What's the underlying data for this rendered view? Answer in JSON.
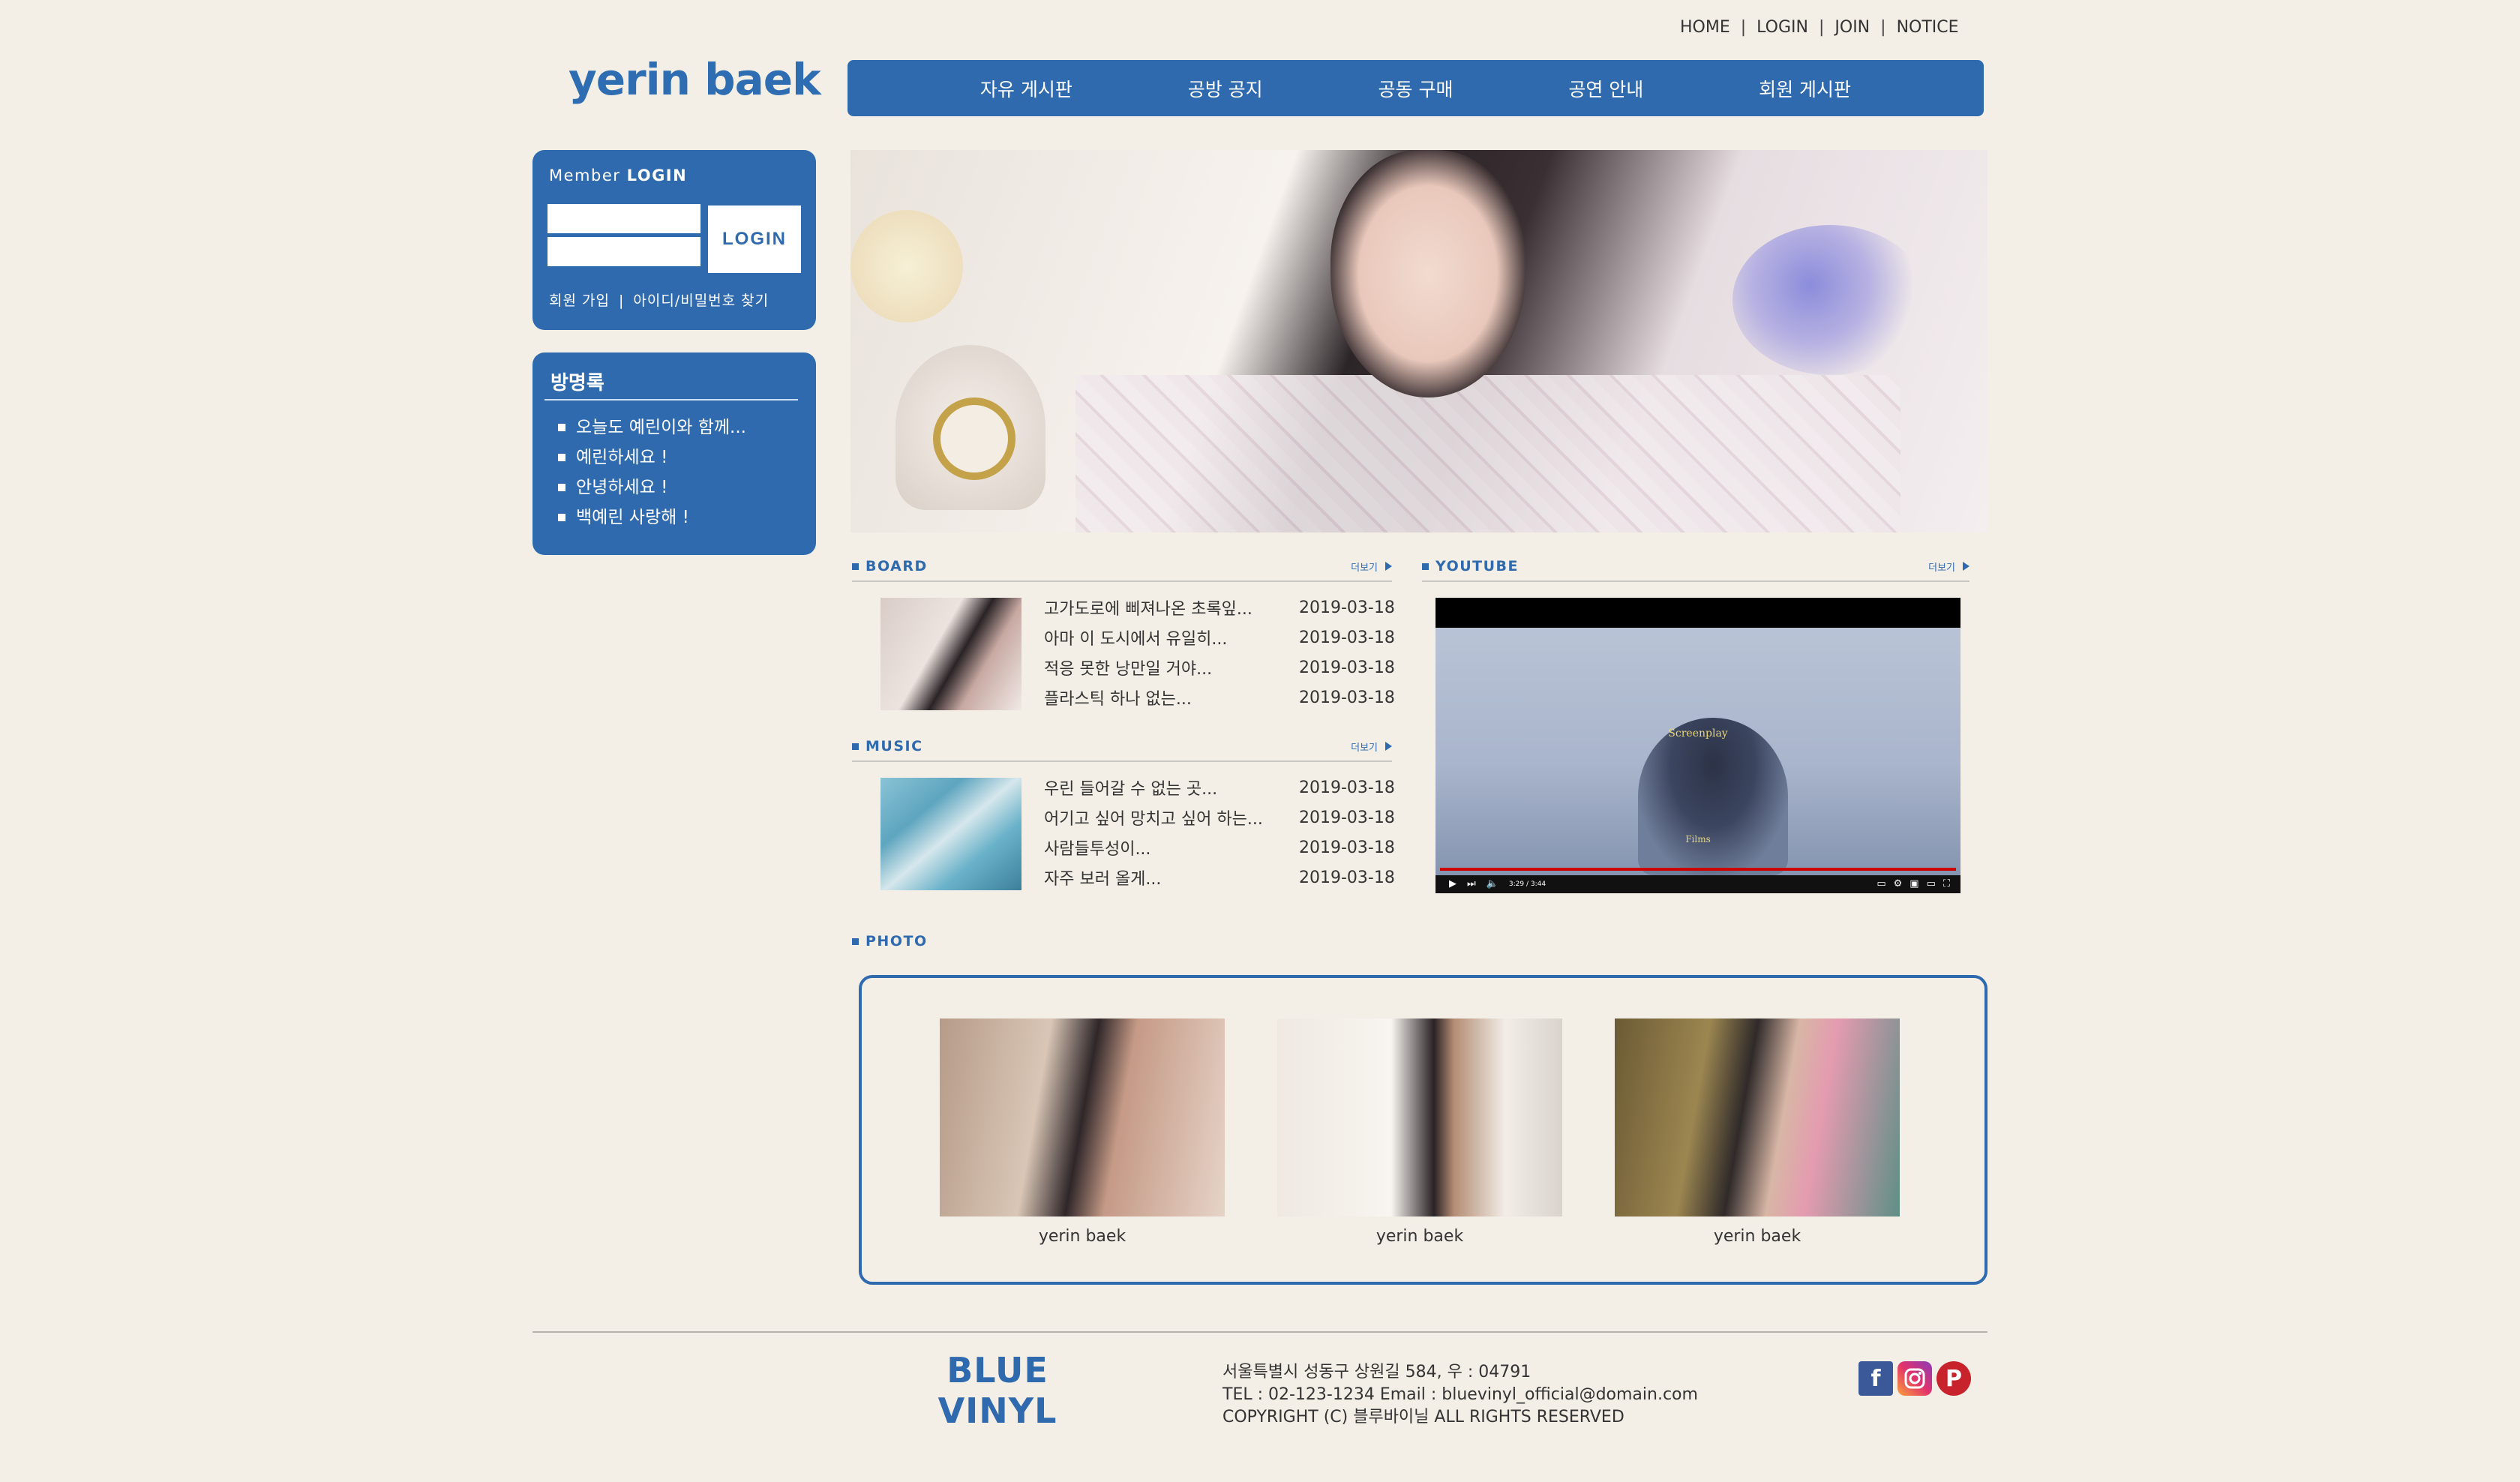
{
  "top_links": [
    "HOME",
    "LOGIN",
    "JOIN",
    "NOTICE"
  ],
  "logo": "yerin baek",
  "nav": [
    "자유 게시판",
    "공방 공지",
    "공동 구매",
    "공연 안내",
    "회원 게시판"
  ],
  "login": {
    "title_prefix": "Member",
    "title_bold": "LOGIN",
    "button": "LOGIN",
    "join": "회원 가입",
    "find": "아이디/비밀번호 찾기"
  },
  "guestbook": {
    "title": "방명록",
    "items": [
      "오늘도 예린이와 함께...",
      "예린하세요 !",
      "안녕하세요 !",
      "백예린 사랑해 !"
    ]
  },
  "board": {
    "title": "BOARD",
    "more": "더보기",
    "rows": [
      {
        "title": "고가도로에 삐져나온 초록잎...",
        "date": "2019-03-18"
      },
      {
        "title": "아마 이 도시에서 유일히...",
        "date": "2019-03-18"
      },
      {
        "title": "적응 못한 낭만일 거야...",
        "date": "2019-03-18"
      },
      {
        "title": "플라스틱 하나 없는...",
        "date": "2019-03-18"
      }
    ]
  },
  "music": {
    "title": "MUSIC",
    "more": "더보기",
    "rows": [
      {
        "title": "우린 들어갈 수 없는 곳...",
        "date": "2019-03-18"
      },
      {
        "title": "어기고 싶어 망치고 싶어 하는...",
        "date": "2019-03-18"
      },
      {
        "title": "사람들투성이...",
        "date": "2019-03-18"
      },
      {
        "title": "자주 보러 올게...",
        "date": "2019-03-18"
      }
    ]
  },
  "youtube": {
    "title": "YOUTUBE",
    "more": "더보기",
    "credits": [
      "Screenplay",
      "Films"
    ],
    "time": "3:29 / 3:44"
  },
  "photo": {
    "title": "PHOTO",
    "captions": [
      "yerin baek",
      "yerin baek",
      "yerin baek"
    ]
  },
  "footer": {
    "brand_line1": "BLUE",
    "brand_line2": "VINYL",
    "address": "서울특별시 성동구 상원길 584, 우 : 04791",
    "contact": "TEL : 02-123-1234 Email : bluevinyl_official@domain.com",
    "copyright": "COPYRIGHT (C) 블루바이닐 ALL RIGHTS RESERVED"
  }
}
